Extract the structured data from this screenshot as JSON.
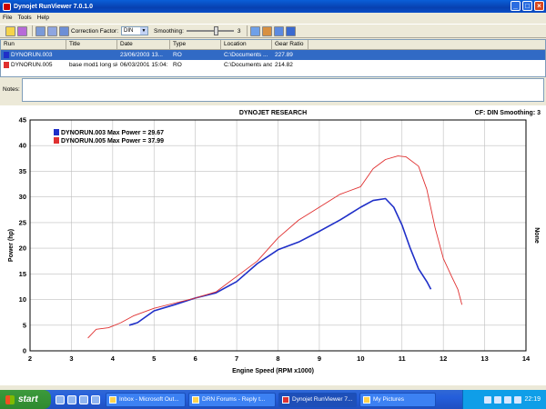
{
  "window": {
    "title": "Dynojet RunViewer 7.0.1.0"
  },
  "menu": [
    "File",
    "Tools",
    "Help"
  ],
  "toolbar": {
    "correction_factor_label": "Correction Factor:",
    "correction_factor_value": "DIN",
    "smoothing_label": "Smoothing:",
    "smoothing_value": "3"
  },
  "table": {
    "headers": [
      "Run",
      "Title",
      "Date",
      "Type",
      "Location",
      "Gear Ratio"
    ],
    "rows": [
      {
        "run": "DYNORUN.003",
        "title": "",
        "date": "23/06/2003 13...",
        "type": "RO",
        "location": "C:\\Documents ...",
        "ratio": "227.89",
        "color": "#1f2fc8",
        "selected": true
      },
      {
        "run": "DYNORUN.005",
        "title": "base mod1 long ski",
        "date": "06/03/2001 15:04:",
        "type": "RO",
        "location": "C:\\Documents and",
        "ratio": "214.82",
        "color": "#e03030",
        "selected": false
      }
    ]
  },
  "notes": {
    "label": "Notes:"
  },
  "chart_data": {
    "type": "line",
    "header_center": "DYNOJET RESEARCH",
    "header_right": "CF: DIN  Smoothing: 3",
    "xlabel": "Engine Speed (RPM x1000)",
    "ylabel": "Power (hp)",
    "right_label": "None",
    "xlim": [
      2,
      14
    ],
    "ylim": [
      0,
      45
    ],
    "xticks": [
      2,
      3,
      4,
      5,
      6,
      7,
      8,
      9,
      10,
      11,
      12,
      13,
      14
    ],
    "yticks": [
      0,
      5,
      10,
      15,
      20,
      25,
      30,
      35,
      40,
      45
    ],
    "legend": [
      "DYNORUN.003 Max Power = 29.67",
      "DYNORUN.005 Max Power = 37.99"
    ],
    "series": [
      {
        "name": "DYNORUN.003",
        "color": "#1f2fc8",
        "x": [
          4.4,
          4.6,
          5.0,
          5.5,
          6.0,
          6.5,
          7.0,
          7.5,
          8.0,
          8.5,
          9.0,
          9.5,
          10.0,
          10.3,
          10.6,
          10.8,
          11.0,
          11.2,
          11.4,
          11.6,
          11.7
        ],
        "y": [
          5.0,
          5.5,
          7.8,
          9.0,
          10.3,
          11.3,
          13.5,
          17.0,
          19.7,
          21.2,
          23.3,
          25.5,
          28.0,
          29.3,
          29.67,
          28.0,
          24.5,
          20.0,
          16.0,
          13.5,
          12.0
        ]
      },
      {
        "name": "DYNORUN.005",
        "color": "#e03030",
        "x": [
          3.4,
          3.6,
          3.9,
          4.2,
          4.5,
          5.0,
          5.5,
          6.0,
          6.5,
          7.0,
          7.5,
          8.0,
          8.5,
          9.0,
          9.5,
          10.0,
          10.3,
          10.6,
          10.9,
          11.1,
          11.4,
          11.6,
          11.8,
          12.0,
          12.2,
          12.35,
          12.45
        ],
        "y": [
          2.5,
          4.2,
          4.5,
          5.5,
          6.8,
          8.3,
          9.3,
          10.3,
          11.5,
          14.5,
          17.5,
          22.0,
          25.5,
          28.0,
          30.5,
          32.0,
          35.5,
          37.3,
          37.99,
          37.8,
          36.0,
          31.5,
          24.0,
          18.0,
          14.5,
          12.0,
          9.0
        ]
      }
    ]
  },
  "taskbar": {
    "start_label": "start",
    "tasks": [
      "Inbox - Microsoft Out...",
      "DRN Forums - Reply t...",
      "Dynojet RunViewer 7...",
      "My Pictures"
    ],
    "clock": "22:19"
  }
}
